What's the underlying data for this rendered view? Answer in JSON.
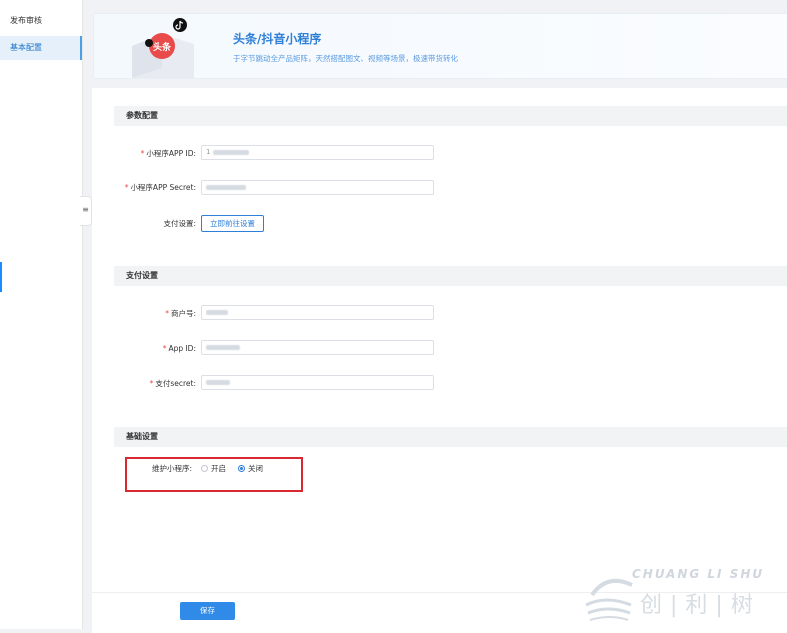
{
  "sidebar": {
    "items": [
      {
        "label": "发布审核",
        "active": false
      },
      {
        "label": "基本配置",
        "active": true
      }
    ],
    "collapse_icon": "≡"
  },
  "banner": {
    "title": "头条/抖音小程序",
    "subtitle": "于字节跳动全产品矩阵，天然搭配图文、视频等场景，极速带货转化",
    "badge_text": "头条"
  },
  "sections": {
    "params": {
      "title": "参数配置",
      "app_id_label": "小程序APP ID:",
      "app_id_value": "1",
      "app_secret_label": "小程序APP Secret:",
      "pay_setting_label": "支付设置:",
      "pay_setting_button": "立即前往设置"
    },
    "payment": {
      "title": "支付设置",
      "merchant_label": "商户号:",
      "app_id_label": "App ID:",
      "secret_label": "支付secret:"
    },
    "basic": {
      "title": "基础设置",
      "maintain_label": "维护小程序:",
      "options": [
        "开启",
        "关闭"
      ],
      "selected": "关闭"
    }
  },
  "footer": {
    "save_label": "保存"
  },
  "watermark": {
    "latin": "CHUANG LI SHU",
    "cn": "创|利|树"
  },
  "colors": {
    "accent": "#2f8ae8",
    "required": "#e84b4b",
    "highlight": "#d9282f"
  }
}
